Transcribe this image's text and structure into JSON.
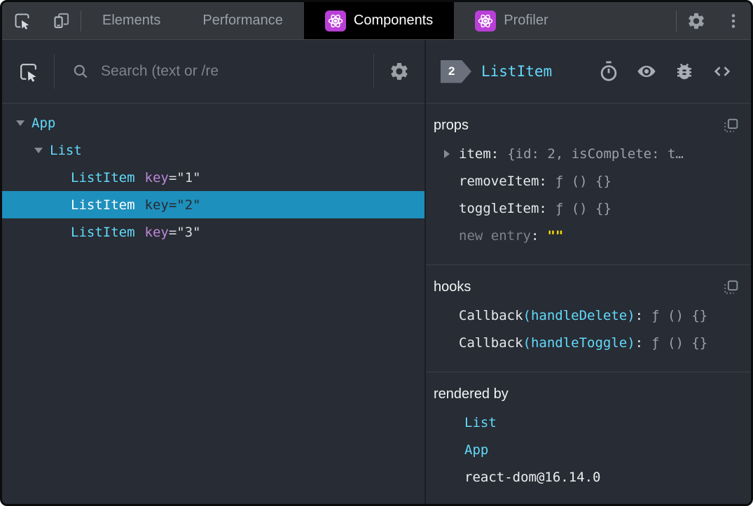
{
  "punct": {
    "colon": ":"
  },
  "colors": {
    "selection_blue": "#1e90bd",
    "component_cyan": "#61dafb",
    "key_purple": "#bd87dc",
    "react_icon_purple": "#b93fd6",
    "editable_yellow": "#ffe000"
  },
  "topbar": {
    "tabs": [
      {
        "label": "Elements"
      },
      {
        "label": "Performance"
      },
      {
        "label": "Components"
      },
      {
        "label": "Profiler"
      }
    ]
  },
  "left": {
    "search_placeholder": "Search (text or /re",
    "tree": {
      "rows": [
        {
          "name": "App"
        },
        {
          "name": "List"
        },
        {
          "name": "ListItem",
          "key_name": "key",
          "key_eq": "=\"1\""
        },
        {
          "name": "ListItem",
          "key_name": "key",
          "key_eq": "=\"2\"",
          "selected": "true"
        },
        {
          "name": "ListItem",
          "key_name": "key",
          "key_eq": "=\"3\""
        }
      ]
    }
  },
  "right": {
    "badge": "2",
    "title": "ListItem",
    "props": {
      "header": "props",
      "rows": [
        {
          "name": "item",
          "value": "{id: 2, isComplete: t…"
        },
        {
          "name": "removeItem",
          "value": "ƒ () {}"
        },
        {
          "name": "toggleItem",
          "value": "ƒ () {}"
        },
        {
          "name": "new entry",
          "value": "\"\""
        }
      ]
    },
    "hooks": {
      "header": "hooks",
      "rows": [
        {
          "fn": "Callback",
          "arg": "(handleDelete)",
          "value": "ƒ () {}"
        },
        {
          "fn": "Callback",
          "arg": "(handleToggle)",
          "value": "ƒ () {}"
        }
      ]
    },
    "rendered_by": {
      "header": "rendered by",
      "links": [
        "List",
        "App"
      ],
      "lib": "react-dom@16.14.0"
    }
  }
}
